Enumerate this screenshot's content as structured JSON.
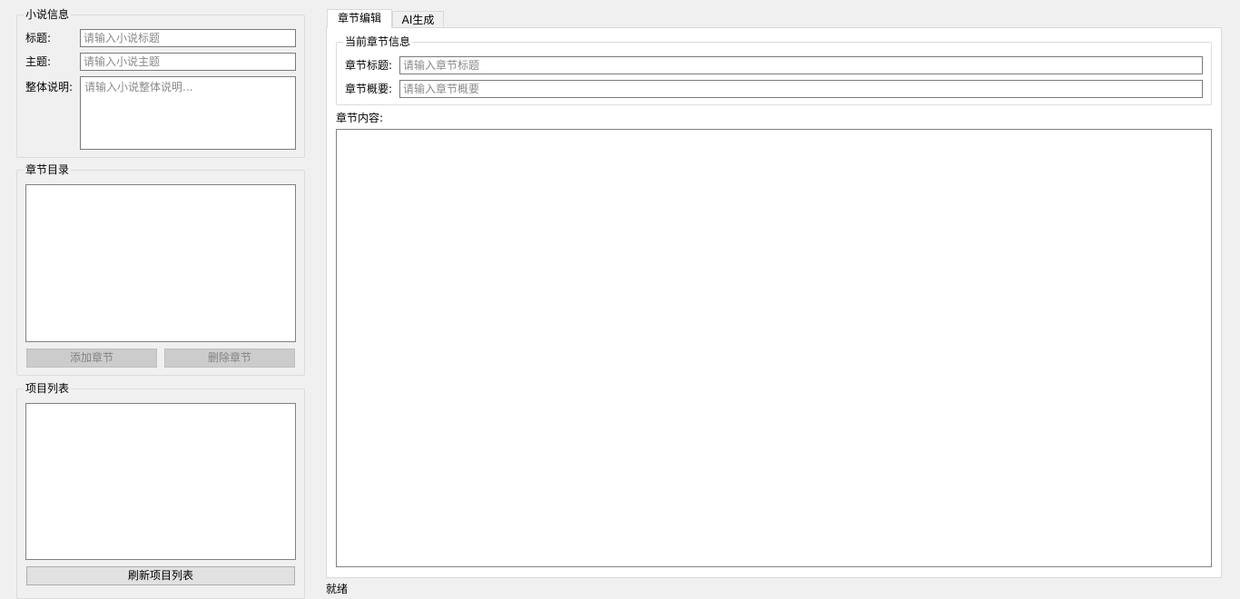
{
  "novel_info": {
    "title": "小说信息",
    "title_label": "标题:",
    "title_placeholder": "请输入小说标题",
    "theme_label": "主题:",
    "theme_placeholder": "请输入小说主题",
    "desc_label": "整体说明:",
    "desc_placeholder": "请输入小说整体说明..."
  },
  "chapter_catalog": {
    "title": "章节目录",
    "add_button": "添加章节",
    "delete_button": "删除章节"
  },
  "project_list": {
    "title": "项目列表",
    "refresh_button": "刷新项目列表"
  },
  "tabs": [
    {
      "label": "章节编辑",
      "active": true
    },
    {
      "label": "AI生成",
      "active": false
    }
  ],
  "chapter_edit": {
    "info_group_title": "当前章节信息",
    "chapter_title_label": "章节标题:",
    "chapter_title_placeholder": "请输入章节标题",
    "chapter_summary_label": "章节概要:",
    "chapter_summary_placeholder": "请输入章节概要",
    "content_label": "章节内容:"
  },
  "status_bar": {
    "text": "就绪"
  }
}
